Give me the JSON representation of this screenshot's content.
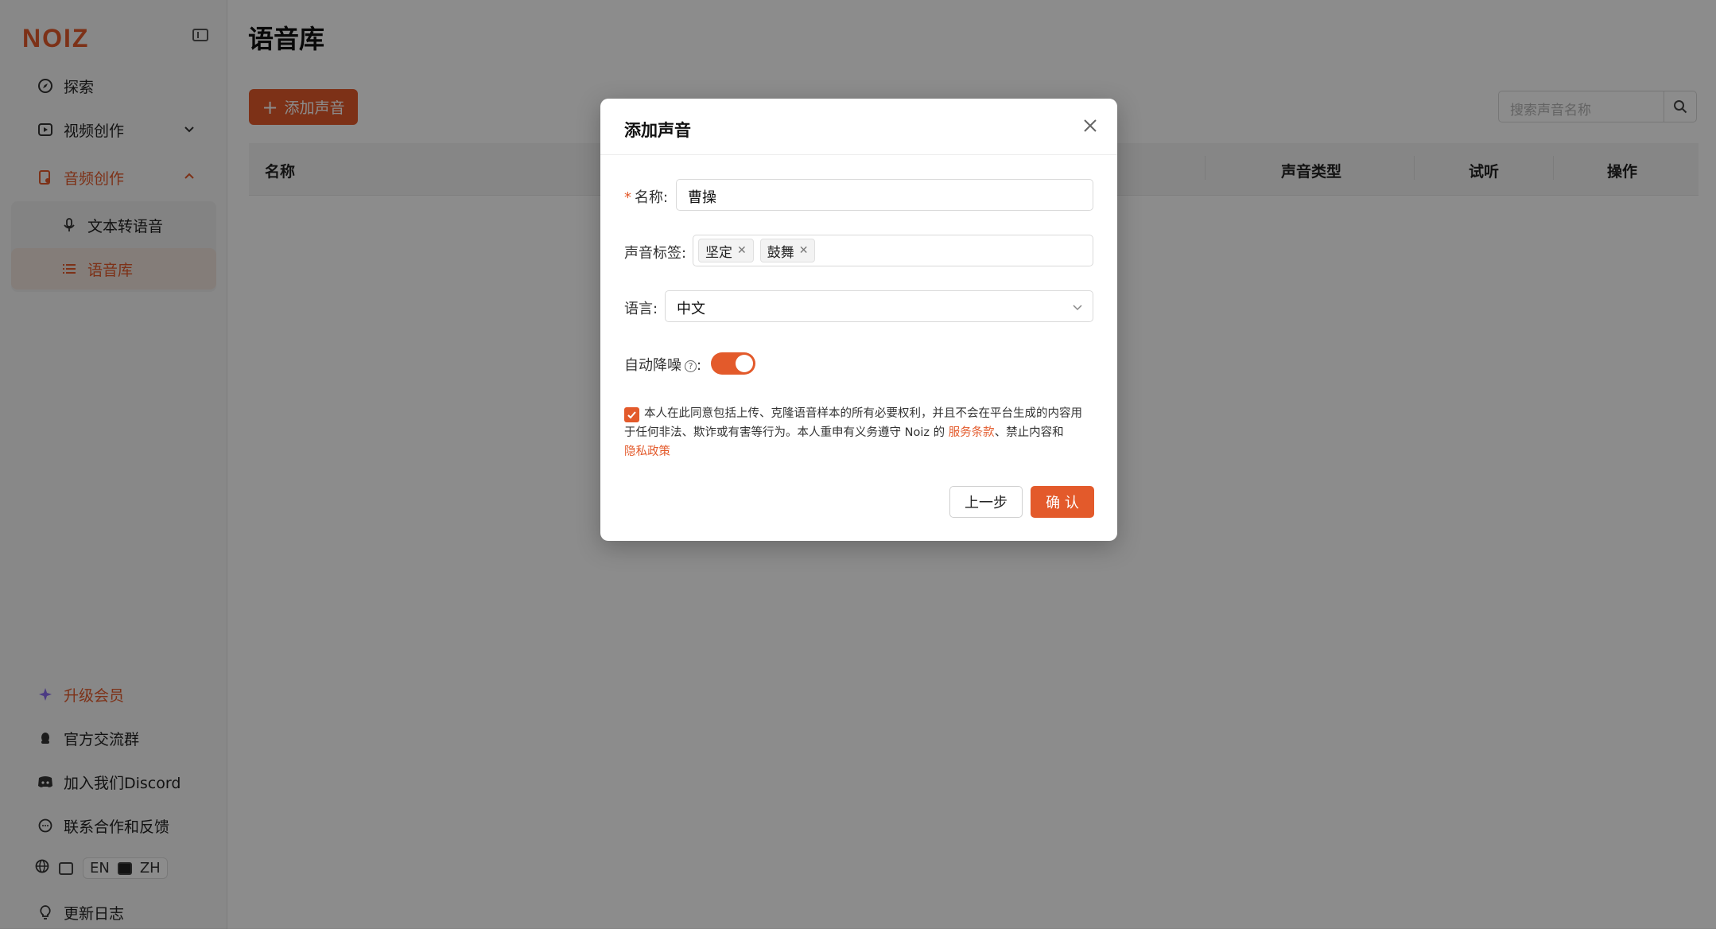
{
  "brand": {
    "logo": "NOIZ",
    "accent": "#e35a2b"
  },
  "sidebar": {
    "items": [
      {
        "label": "探索"
      },
      {
        "label": "视频创作"
      },
      {
        "label": "音频创作"
      },
      {
        "label": "文本转语音"
      },
      {
        "label": "语音库"
      }
    ],
    "footer": [
      {
        "label": "升级会员"
      },
      {
        "label": "官方交流群"
      },
      {
        "label": "加入我们Discord"
      },
      {
        "label": "联系合作和反馈"
      },
      {
        "label": "更新日志"
      }
    ],
    "lang": {
      "en": "EN",
      "zh": "ZH",
      "selected": "ZH"
    }
  },
  "main": {
    "title": "语音库",
    "add_button": "添加声音",
    "search_placeholder": "搜索声音名称",
    "columns": [
      "名称",
      "声音类型",
      "试听",
      "操作"
    ]
  },
  "modal": {
    "title": "添加声音",
    "name_label": "名称",
    "name_value": "曹操",
    "tags_label": "声音标签",
    "tags": [
      "坚定",
      "鼓舞"
    ],
    "language_label": "语言",
    "language_value": "中文",
    "denoise_label": "自动降噪",
    "denoise_on": true,
    "agree_checked": true,
    "agree_text": "本人在此同意包括上传、克隆语音样本的所有必要权利，并且不会在平台生成的内容用于任何非法、欺诈或有害等行为。本人重申有义务遵守 Noiz 的 ",
    "terms_link": "服务条款",
    "agree_mid": "、禁止内容和",
    "privacy_link": "隐私政策",
    "prev_button": "上一步",
    "confirm_button": "确 认"
  }
}
